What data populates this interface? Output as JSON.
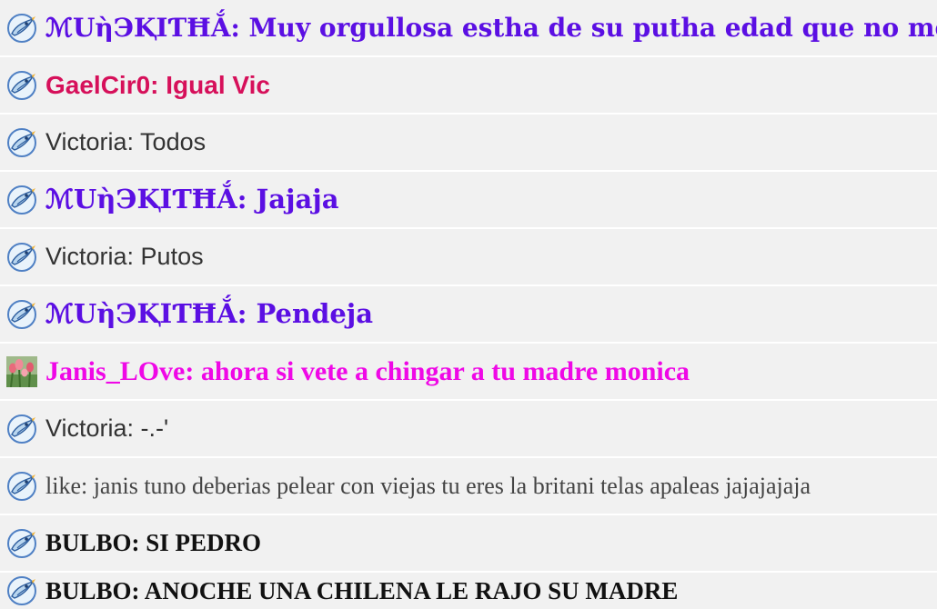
{
  "messages": [
    {
      "avatar": "bird-icon",
      "text": "ℳUὴЭⱩIƬĦẮ: Muy orgullosa estha de su putha edad que no me la dijo",
      "style": "serif-bold-purple"
    },
    {
      "avatar": "bird-icon",
      "text": "GaelCir0: Igual Vic",
      "style": "sans-bold-crimson"
    },
    {
      "avatar": "bird-icon",
      "text": "Victoria: Todos",
      "style": "sans-regular-gray"
    },
    {
      "avatar": "bird-icon",
      "text": "ℳUὴЭⱩIƬĦẮ: Jajaja",
      "style": "serif-bold-purple"
    },
    {
      "avatar": "bird-icon",
      "text": "Victoria: Putos",
      "style": "sans-regular-gray"
    },
    {
      "avatar": "bird-icon",
      "text": "ℳUὴЭⱩIƬĦẮ: Pendeja",
      "style": "serif-bold-purple"
    },
    {
      "avatar": "tulips-photo-icon",
      "text": "Janis_LOve: ahora si vete a chingar a tu madre monica",
      "style": "serif-bold-magenta"
    },
    {
      "avatar": "bird-icon",
      "text": "Victoria: -.-'",
      "style": "sans-regular-gray"
    },
    {
      "avatar": "bird-icon",
      "text": "like: janis tuno deberias pelear con viejas tu eres la britani telas apaleas jajajajaja",
      "style": "serif-regular-gray"
    },
    {
      "avatar": "bird-icon",
      "text": "BULBO: SI PEDRO",
      "style": "serif-bold-black"
    },
    {
      "avatar": "bird-icon",
      "text": "BULBO: ANOCHE UNA CHILENA LE RAJO SU MADRE",
      "style": "serif-bold-black"
    }
  ],
  "colors": {
    "row_background": "#f1f1f1",
    "purple": "#5b0fe3",
    "crimson": "#d6105a",
    "magenta": "#ef08e6",
    "gray_text": "#333333",
    "black_text": "#111111"
  }
}
